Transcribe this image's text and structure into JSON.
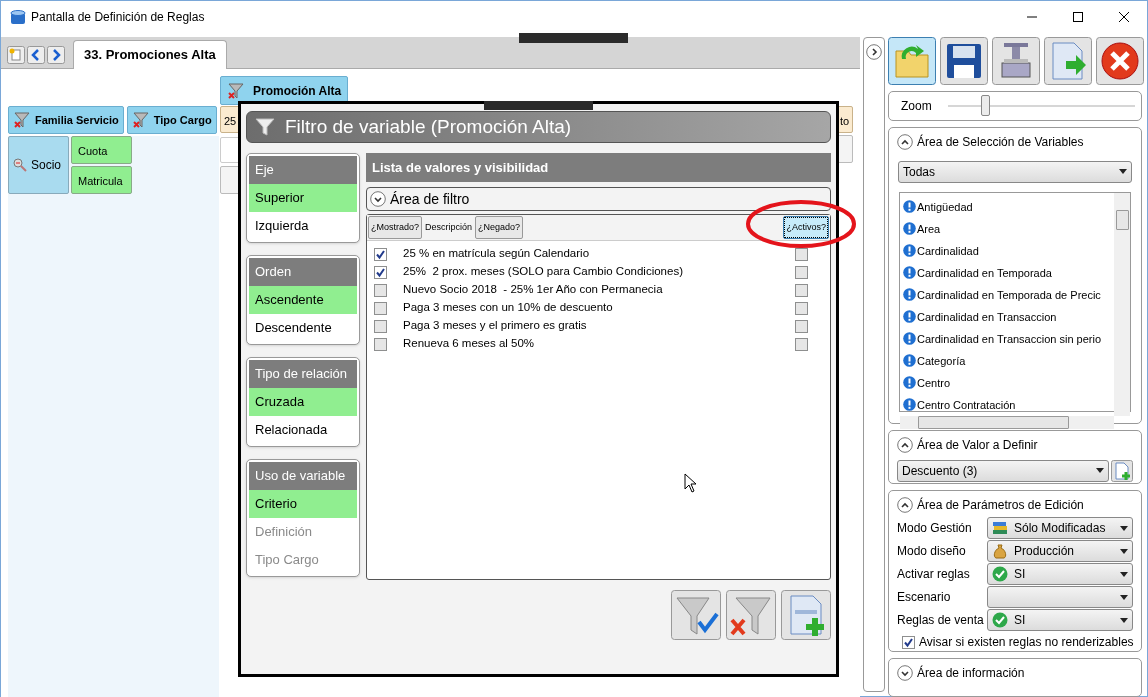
{
  "window": {
    "title": "Pantalla de Definición de Reglas"
  },
  "tabs": [
    {
      "label": "33. Promociones Alta",
      "selected": true
    }
  ],
  "canvas": {
    "column_header": "Promoción Alta",
    "row_headers": [
      "Familia Servicio",
      "Tipo Cargo"
    ],
    "row_item": {
      "label": "Socio",
      "children": [
        "Cuota",
        "Matricula"
      ]
    },
    "background_cells": [
      "25",
      "to"
    ]
  },
  "dialog": {
    "title": "Filtro de variable (Promoción Alta)",
    "groups": [
      {
        "title": "Eje",
        "options": [
          {
            "label": "Superior",
            "selected": true,
            "disabled": false
          },
          {
            "label": "Izquierda",
            "selected": false,
            "disabled": false
          }
        ]
      },
      {
        "title": "Orden",
        "options": [
          {
            "label": "Ascendente",
            "selected": true,
            "disabled": false
          },
          {
            "label": "Descendente",
            "selected": false,
            "disabled": false
          }
        ]
      },
      {
        "title": "Tipo de relación",
        "options": [
          {
            "label": "Cruzada",
            "selected": true,
            "disabled": false
          },
          {
            "label": "Relacionada",
            "selected": false,
            "disabled": false
          }
        ]
      },
      {
        "title": "Uso de variable",
        "options": [
          {
            "label": "Criterio",
            "selected": true,
            "disabled": false
          },
          {
            "label": "Definición",
            "selected": false,
            "disabled": true
          },
          {
            "label": "Tipo Cargo",
            "selected": false,
            "disabled": true
          }
        ]
      }
    ],
    "list_title": "Lista de valores y visibilidad",
    "filter_area": {
      "label": "Área de filtro",
      "expanded": false
    },
    "columns": [
      {
        "label": "¿Mostrado?",
        "kind": "button",
        "focused": false
      },
      {
        "label": "Descripción",
        "kind": "plain",
        "focused": false
      },
      {
        "label": "¿Negado?",
        "kind": "button",
        "focused": false
      },
      {
        "label": "¿Activos?",
        "kind": "button",
        "focused": true
      }
    ],
    "rows": [
      {
        "shown": true,
        "description": "25 % en matrícula según Calendario",
        "active": false
      },
      {
        "shown": true,
        "description": "25%  2 prox. meses (SOLO para Cambio Condiciones)",
        "active": false
      },
      {
        "shown": false,
        "description": "Nuevo Socio 2018  - 25% 1er Año con Permanecia",
        "active": false
      },
      {
        "shown": false,
        "description": "Paga 3 meses con un 10% de descuento",
        "active": false
      },
      {
        "shown": false,
        "description": "Paga 3 meses y el primero es gratis",
        "active": false
      },
      {
        "shown": false,
        "description": "Renueva 6 meses al 50%",
        "active": false
      }
    ]
  },
  "right_panel": {
    "zoom": {
      "label": "Zoom",
      "level": 0.2
    },
    "variable_selection": {
      "title": "Área de Selección de Variables",
      "expanded": true,
      "filter": "Todas",
      "variables": [
        "Antigüedad",
        "Area",
        "Cardinalidad",
        "Cardinalidad en Temporada",
        "Cardinalidad en Temporada de Precic",
        "Cardinalidad en Transaccion",
        "Cardinalidad en Transaccion sin perio",
        "Categoría",
        "Centro",
        "Centro Contratación"
      ]
    },
    "value_area": {
      "title": "Área de Valor a Definir",
      "expanded": true,
      "value": "Descuento (3)"
    },
    "edit_parameters": {
      "title": "Área de Parámetros de Edición",
      "expanded": true,
      "fields": [
        {
          "label": "Modo Gestión",
          "value": "Sólo Modificadas",
          "kind": "books"
        },
        {
          "label": "Modo diseño",
          "value": "Producción",
          "kind": "moneybag"
        },
        {
          "label": "Activar reglas",
          "value": "SI",
          "kind": "check"
        },
        {
          "label": "Escenario",
          "kind": "empty"
        },
        {
          "label": "Reglas de venta",
          "value": "SI",
          "kind": "check"
        }
      ],
      "warning": {
        "label": "Avisar si existen reglas no renderizables",
        "checked": true
      }
    },
    "info_area": {
      "title": "Área de información",
      "expanded": false
    }
  }
}
